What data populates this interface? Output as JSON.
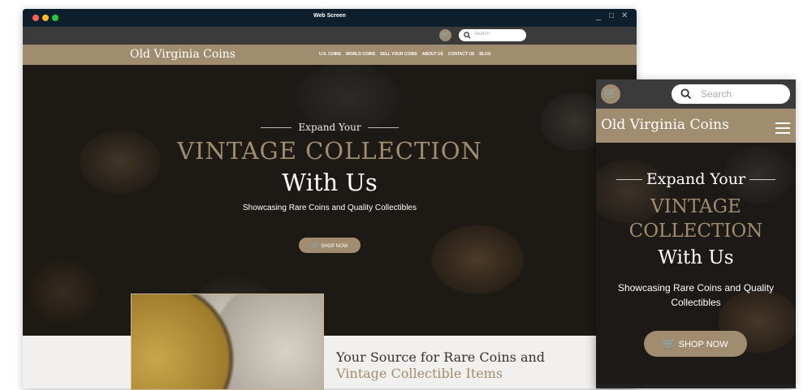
{
  "window": {
    "title": "Web Screen",
    "controls": [
      "_",
      "□",
      "✕"
    ]
  },
  "colors": {
    "accent": "#a08c6e",
    "topbar": "#3b3b3b",
    "titlebar": "#0d1f2d"
  },
  "search": {
    "placeholder": "Search"
  },
  "brand": "Old Virginia Coins",
  "nav": [
    "U.S. COINS",
    "WORLD COINS",
    "SELL YOUR COINS",
    "ABOUT US",
    "CONTACT US",
    "BLOG"
  ],
  "hero": {
    "kicker": "Expand Your",
    "headline": "VINTAGE COLLECTION",
    "headline_mobile_1": "VINTAGE",
    "headline_mobile_2": "COLLECTION",
    "subhead": "With Us",
    "tagline": "Showcasing Rare Coins and Quality Collectibles",
    "cta": "SHOP NOW"
  },
  "section": {
    "title": "Your Source for Rare Coins and",
    "subtitle": "Vintage Collectible Items"
  },
  "icons": {
    "cart": "shopping-cart-icon",
    "search": "search-icon",
    "menu": "hamburger-menu-icon"
  }
}
